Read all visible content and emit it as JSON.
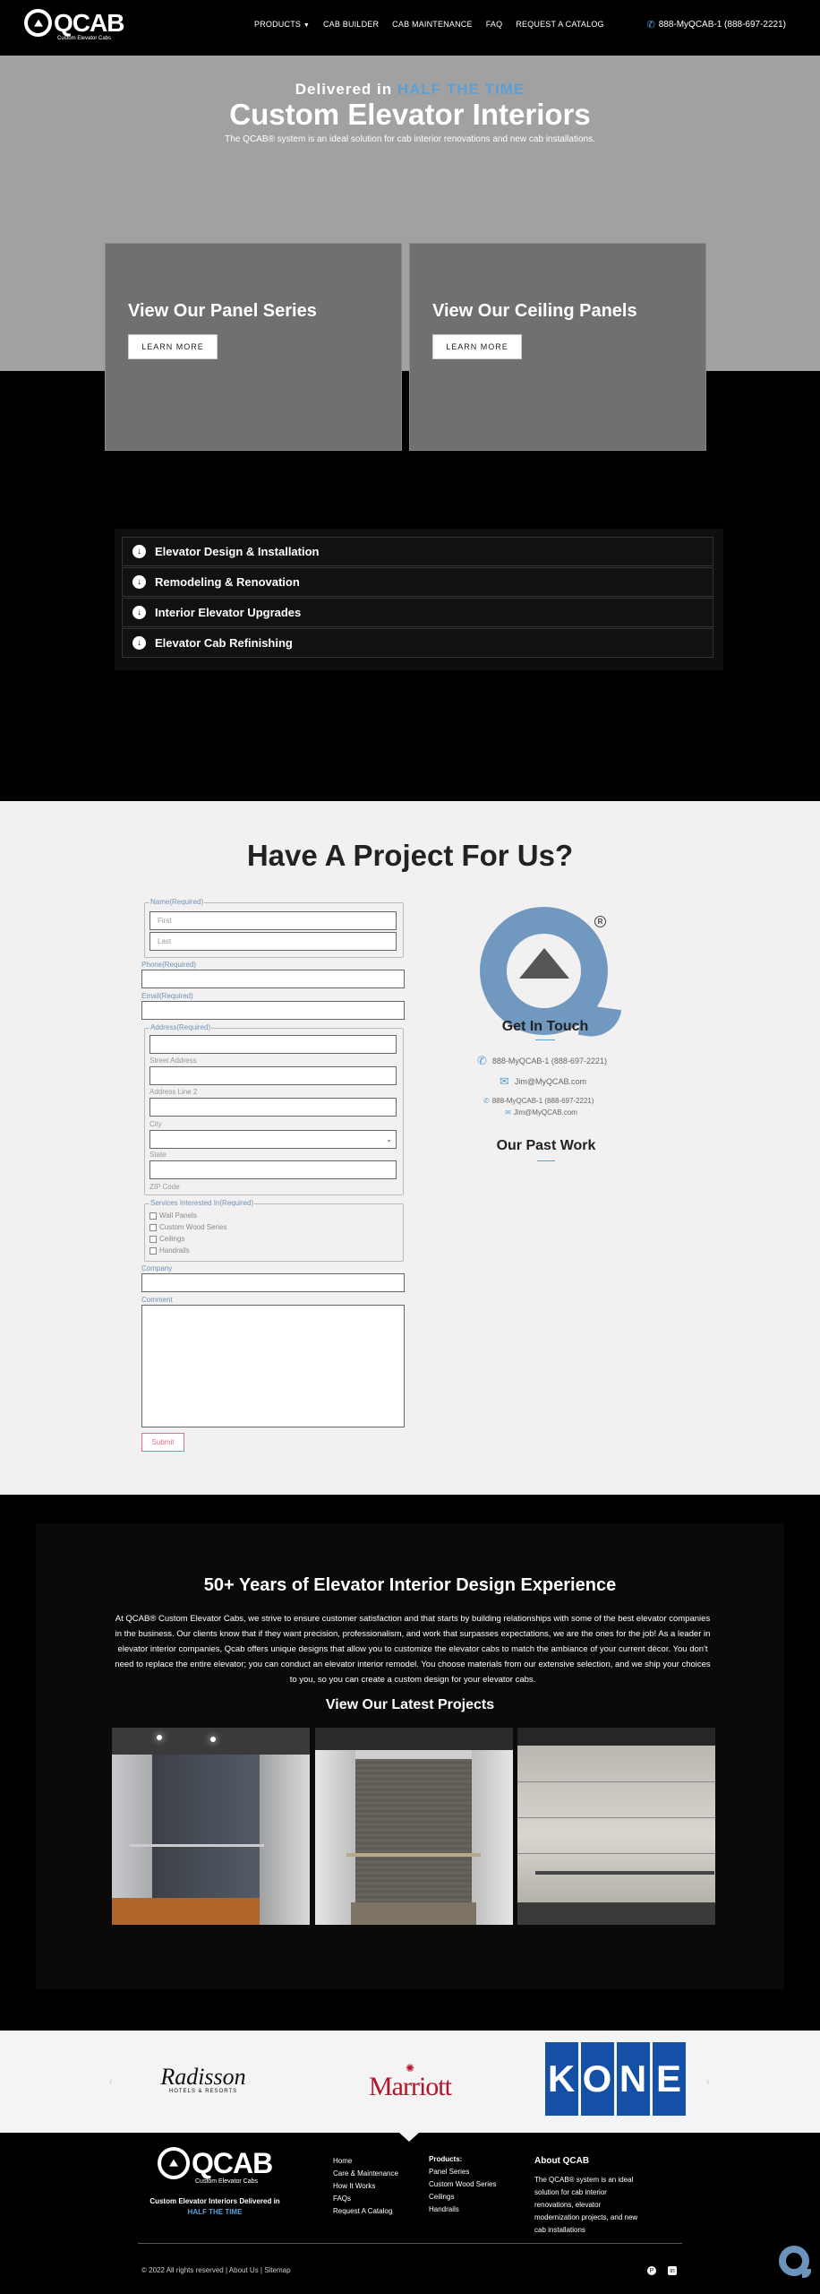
{
  "header": {
    "logo_word": "QCAB",
    "logo_sub": "Custom Elevator Cabs",
    "nav": [
      {
        "label": "PRODUCTS",
        "caret": "▼"
      },
      {
        "label": "CAB BUILDER"
      },
      {
        "label": "CAB MAINTENANCE"
      },
      {
        "label": "FAQ"
      },
      {
        "label": "REQUEST A CATALOG"
      }
    ],
    "phone": "888-MyQCAB-1 (888-697-2221)",
    "phone_icon": "phone-icon"
  },
  "hero": {
    "kicker_prefix": "Delivered in",
    "kicker_accent": "HALF THE TIME",
    "title": "Custom Elevator Interiors",
    "subtitle": "The QCAB® system is an ideal solution for cab interior renovations and new cab installations.",
    "cards": [
      {
        "title": "View Our Panel Series",
        "button": "LEARN MORE"
      },
      {
        "title": "View Our Ceiling Panels",
        "button": "LEARN MORE"
      }
    ]
  },
  "services": {
    "items": [
      {
        "label": "Elevator Design & Installation",
        "icon": "arrow-down-circle-icon"
      },
      {
        "label": "Remodeling & Renovation",
        "icon": "arrow-down-circle-icon"
      },
      {
        "label": "Interior Elevator Upgrades",
        "icon": "arrow-down-circle-icon"
      },
      {
        "label": "Elevator Cab Refinishing",
        "icon": "arrow-down-circle-icon"
      }
    ],
    "icon_glyph": "↓"
  },
  "form": {
    "title": "Have A Project For Us?",
    "name_label": "Name(Required)",
    "first_placeholder": "First",
    "last_placeholder": "Last",
    "phone_label": "Phone(Required)",
    "email_label": "Email(Required)",
    "address_label": "Address(Required)",
    "street_label": "Street Address",
    "address2_label": "Address Line 2",
    "city_label": "City",
    "state_label": "State",
    "zip_label": "ZIP Code",
    "services_label": "Services Interested In(Required)",
    "services": [
      "Wall Panels",
      "Custom Wood Series",
      "Ceilings",
      "Handrails"
    ],
    "company_label": "Company",
    "comment_label": "Comment",
    "submit": "Submit"
  },
  "contact": {
    "registered": "R",
    "title": "Get In Touch",
    "phone": "888-MyQCAB-1 (888-697-2221)",
    "email": "Jim@MyQCAB.com",
    "phone_small": "888-MyQCAB-1 (888-697-2221)",
    "email_small": "Jim@MyQCAB.com",
    "past_work": "Our Past Work"
  },
  "experience": {
    "title": "50+ Years of Elevator Interior Design Experience",
    "text": "At QCAB® Custom Elevator Cabs, we strive to ensure customer satisfaction and that starts by building relationships with some of the best elevator companies in the business. Our clients know that if they want precision, professionalism, and work that surpasses expectations, we are the ones for the job! As a leader in elevator interior companies, Qcab offers unique designs that allow you to customize the elevator cabs to match the ambiance of your current décor. You don't need to replace the entire elevator; you can conduct an elevator interior remodel. You choose materials from our extensive selection, and we ship your choices to you, so you can create a custom design for your elevator cabs.",
    "subtitle": "View Our Latest Projects"
  },
  "clients": {
    "radisson": "Radisson",
    "radisson_sub": "HOTELS & RESORTS",
    "marriott": "Marriott",
    "kone": [
      "K",
      "O",
      "N",
      "E"
    ],
    "prev": "‹",
    "next": "›"
  },
  "footer": {
    "tag_line": "Custom Elevator Interiors Delivered in",
    "tag_accent": "HALF THE TIME",
    "links": [
      "Home",
      "Care & Maintenance",
      "How It Works",
      "FAQs",
      "Request A Catalog"
    ],
    "products_heading": "Products:",
    "products": [
      "Panel Series",
      "Custom Wood Series",
      "Ceilings",
      "Handrails"
    ],
    "about_heading": "About QCAB",
    "about_text": "The QCAB® system is an ideal solution for cab interior renovations, elevator modernization projects, and new cab installations",
    "copyright": "© 2022 All rights reserved | About Us | Sitemap",
    "social": [
      "P",
      "in"
    ]
  },
  "colors": {
    "accent": "#5aa0d6",
    "logo_blue": "#7198bf",
    "marriott_red": "#b5152b",
    "kone_blue": "#1450a5"
  }
}
